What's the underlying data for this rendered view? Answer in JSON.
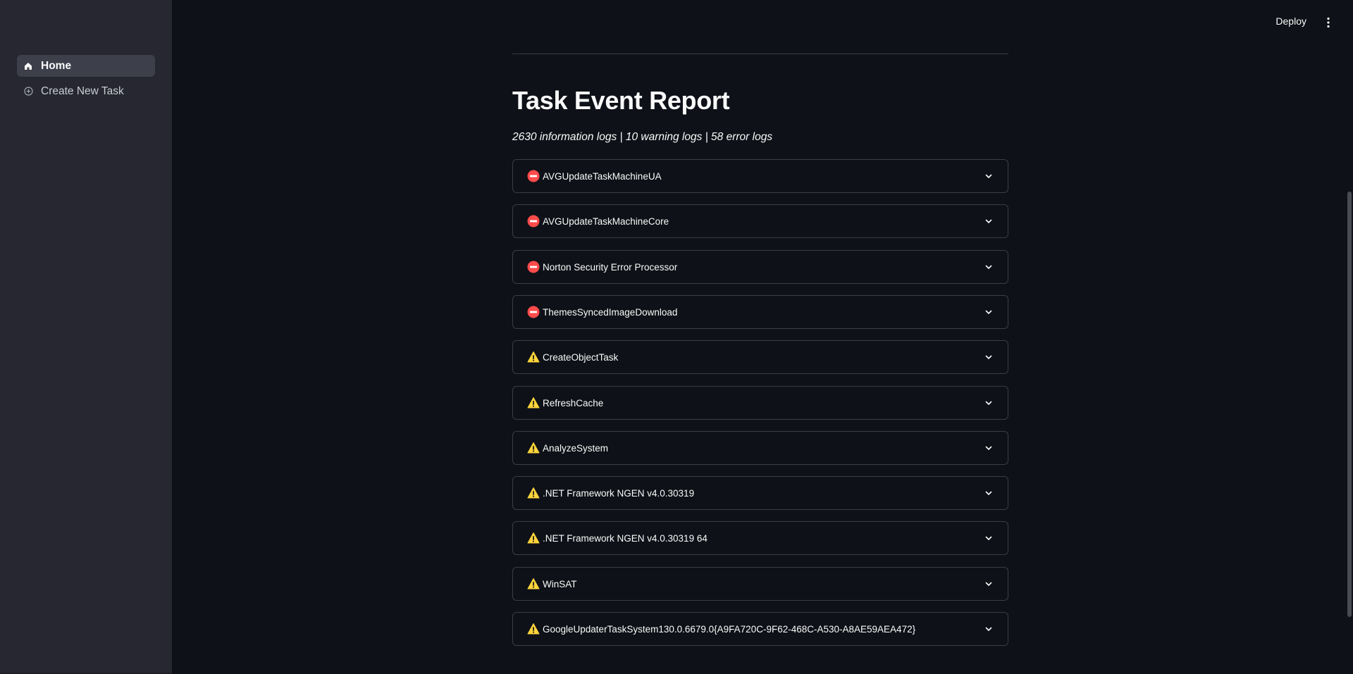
{
  "sidebar": {
    "items": [
      {
        "label": "Home",
        "icon": "home-icon",
        "active": true
      },
      {
        "label": "Create New Task",
        "icon": "add-circle-icon",
        "active": false
      }
    ]
  },
  "header": {
    "deploy_label": "Deploy",
    "menu_icon": "more-vertical-icon"
  },
  "main": {
    "title": "Task Event Report",
    "summary": "2630 information logs | 10 warning logs | 58 error logs",
    "expanders": [
      {
        "label": "AVGUpdateTaskMachineUA",
        "status": "error"
      },
      {
        "label": "AVGUpdateTaskMachineCore",
        "status": "error"
      },
      {
        "label": "Norton Security Error Processor",
        "status": "error"
      },
      {
        "label": "ThemesSyncedImageDownload",
        "status": "error"
      },
      {
        "label": "CreateObjectTask",
        "status": "warning"
      },
      {
        "label": "RefreshCache",
        "status": "warning"
      },
      {
        "label": "AnalyzeSystem",
        "status": "warning"
      },
      {
        "label": ".NET Framework NGEN v4.0.30319",
        "status": "warning"
      },
      {
        "label": ".NET Framework NGEN v4.0.30319 64",
        "status": "warning"
      },
      {
        "label": "WinSAT",
        "status": "warning"
      },
      {
        "label": "GoogleUpdaterTaskSystem130.0.6679.0{A9FA720C-9F62-468C-A530-A8AE59AEA472}",
        "status": "warning"
      }
    ]
  },
  "colors": {
    "background": "#0e1117",
    "sidebar": "#262730",
    "error": "#ff4b4b",
    "warning": "#ffd43b"
  }
}
